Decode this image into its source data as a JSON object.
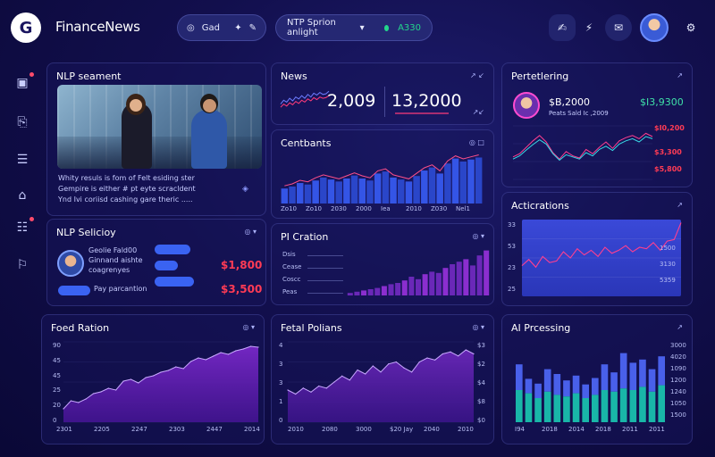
{
  "app": {
    "logo_letter": "G",
    "title": "FinanceNews"
  },
  "header": {
    "search_label": "Gad",
    "filter_label": "NTP Sprion anlight",
    "status_value": "A330",
    "status_color": "#23d68b"
  },
  "nlp_sentiment": {
    "title": "NLP seament",
    "caption_lines": [
      "Whity resuls is fom of Felt esiding ster",
      "Gempire is either # pt eyte scracldent",
      "Ynd Ivi coriisd cashing gare theric ....."
    ]
  },
  "nlp_selection": {
    "title": "NLP Selicioy",
    "person_lines": [
      "Geolie Fald00",
      "Ginnand aishte",
      "coagrenyes"
    ],
    "tag_label": "Pay parcantion",
    "values": [
      "$1,800",
      "$3,500"
    ]
  },
  "news": {
    "title": "News",
    "metric_a": "2,009",
    "metric_b": "13,2000"
  },
  "contents": {
    "title": "Centbants",
    "x_ticks": [
      "Zo10",
      "Zo10",
      "2030",
      "2000",
      "Iea",
      "2010",
      "Z030",
      "Nel1"
    ]
  },
  "pi_creation": {
    "title": "PI Cration",
    "row_labels": [
      "Dsis",
      "Cease",
      "Coscc",
      "Peas"
    ]
  },
  "portfolio": {
    "title": "Pertetlering",
    "value_a": "$B,2000",
    "value_b": "$I3,9300",
    "sub": "Peats Sald Ic ,2009",
    "right_values": [
      "$I0,200",
      "$3,300",
      "$5,800"
    ]
  },
  "activations": {
    "title": "Acticrations",
    "y_ticks": [
      "33",
      "53",
      "23",
      "25"
    ],
    "right_labels": [
      "1500",
      "3130",
      "5359"
    ]
  },
  "fund_ration": {
    "title": "Foed Ration",
    "y_ticks": [
      "90",
      "45",
      "45",
      "25",
      "20",
      "0"
    ],
    "x_ticks": [
      "2301",
      "2205",
      "2247",
      "2303",
      "2447",
      "2014"
    ]
  },
  "fetal_pulsions": {
    "title": "Fetal Polians",
    "y_ticks": [
      "4",
      "3",
      "3",
      "1",
      "0"
    ],
    "right_ticks": [
      "$3",
      "$2",
      "$4",
      "$8",
      "$0"
    ],
    "x_ticks": [
      "2010",
      "2080",
      "3000",
      "$20 Jay",
      "2040",
      "2010"
    ]
  },
  "ai_processing": {
    "title": "AI Prcessing",
    "right_ticks": [
      "3000",
      "4020",
      "1090",
      "1200",
      "1240",
      "1050",
      "1500"
    ],
    "x_ticks": [
      "I94",
      "2018",
      "2014",
      "2018",
      "2011",
      "2011"
    ]
  },
  "chart_data": [
    {
      "type": "area",
      "title": "Foed Ration",
      "x": [
        "2301",
        "2205",
        "2247",
        "2303",
        "2447",
        "2014"
      ],
      "values": [
        15,
        24,
        22,
        26,
        32,
        34,
        38,
        36,
        46,
        48,
        44,
        50,
        52,
        56,
        58,
        62,
        60,
        68,
        72,
        70,
        74,
        78,
        76,
        80,
        82,
        85,
        84
      ],
      "ylim": [
        0,
        90
      ]
    },
    {
      "type": "area",
      "title": "Fetal Polians",
      "values": [
        1.6,
        1.4,
        1.7,
        1.5,
        1.8,
        1.7,
        2.0,
        2.3,
        2.1,
        2.6,
        2.4,
        2.8,
        2.5,
        2.9,
        3.0,
        2.7,
        2.5,
        3.0,
        3.2,
        3.1,
        3.4,
        3.5,
        3.3,
        3.6,
        3.4
      ],
      "ylim": [
        0,
        4
      ]
    },
    {
      "type": "bar",
      "title": "AI Prcessing",
      "x": [
        "I94",
        "2018",
        "2014",
        "2018",
        "2011",
        "2011"
      ],
      "series": [
        {
          "values": [
            72,
            54,
            48,
            66,
            60,
            52,
            58,
            47,
            55,
            72,
            62,
            86,
            74,
            78,
            66,
            82
          ]
        },
        {
          "values": [
            40,
            36,
            30,
            38,
            34,
            32,
            36,
            30,
            34,
            40,
            38,
            42,
            40,
            44,
            38,
            46
          ]
        }
      ],
      "colors": [
        "#4960ea",
        "#19b6a8"
      ],
      "ylim": [
        0,
        100
      ]
    },
    {
      "type": "bar",
      "title": "Centbants",
      "values": [
        30,
        34,
        41,
        38,
        46,
        52,
        48,
        44,
        50,
        56,
        50,
        46,
        60,
        64,
        52,
        48,
        44,
        55,
        66,
        72,
        60,
        80,
        90,
        84,
        88,
        92
      ],
      "ylim": [
        0,
        100
      ]
    },
    {
      "type": "bar",
      "title": "PI Cration",
      "values": [
        4,
        6,
        8,
        10,
        12,
        15,
        18,
        20,
        24,
        30,
        26,
        34,
        38,
        36,
        44,
        50,
        54,
        58,
        48,
        64,
        72
      ],
      "ylim": [
        0,
        80
      ]
    },
    {
      "type": "line",
      "title": "Acticrations",
      "values": [
        40,
        48,
        38,
        52,
        44,
        46,
        58,
        50,
        62,
        54,
        60,
        52,
        64,
        56,
        60,
        66,
        58,
        64,
        62,
        70,
        60,
        72,
        74,
        96
      ],
      "ylim": [
        0,
        100
      ]
    },
    {
      "type": "line",
      "title": "Pertetlering",
      "series": [
        {
          "values": [
            42,
            48,
            60,
            72,
            82,
            70,
            50,
            38,
            52,
            44,
            40,
            56,
            48,
            60,
            70,
            58,
            72,
            78,
            82,
            76,
            86,
            80
          ]
        },
        {
          "values": [
            38,
            44,
            55,
            65,
            74,
            66,
            48,
            36,
            46,
            42,
            38,
            50,
            44,
            56,
            62,
            54,
            66,
            72,
            76,
            70,
            80,
            76
          ]
        }
      ],
      "colors": [
        "#ff3f8f",
        "#39d9e6"
      ]
    },
    {
      "type": "line",
      "title": "News",
      "series": [
        {
          "values": [
            40,
            52,
            46,
            58,
            50,
            62,
            56,
            66,
            58,
            70,
            62,
            74,
            68,
            76,
            70,
            72,
            80
          ]
        },
        {
          "values": [
            30,
            40,
            34,
            44,
            38,
            48,
            42,
            52,
            46,
            56,
            50,
            60,
            54,
            62,
            58,
            60,
            66
          ]
        }
      ],
      "colors": [
        "#6d7cff",
        "#ff3b7a"
      ]
    }
  ]
}
